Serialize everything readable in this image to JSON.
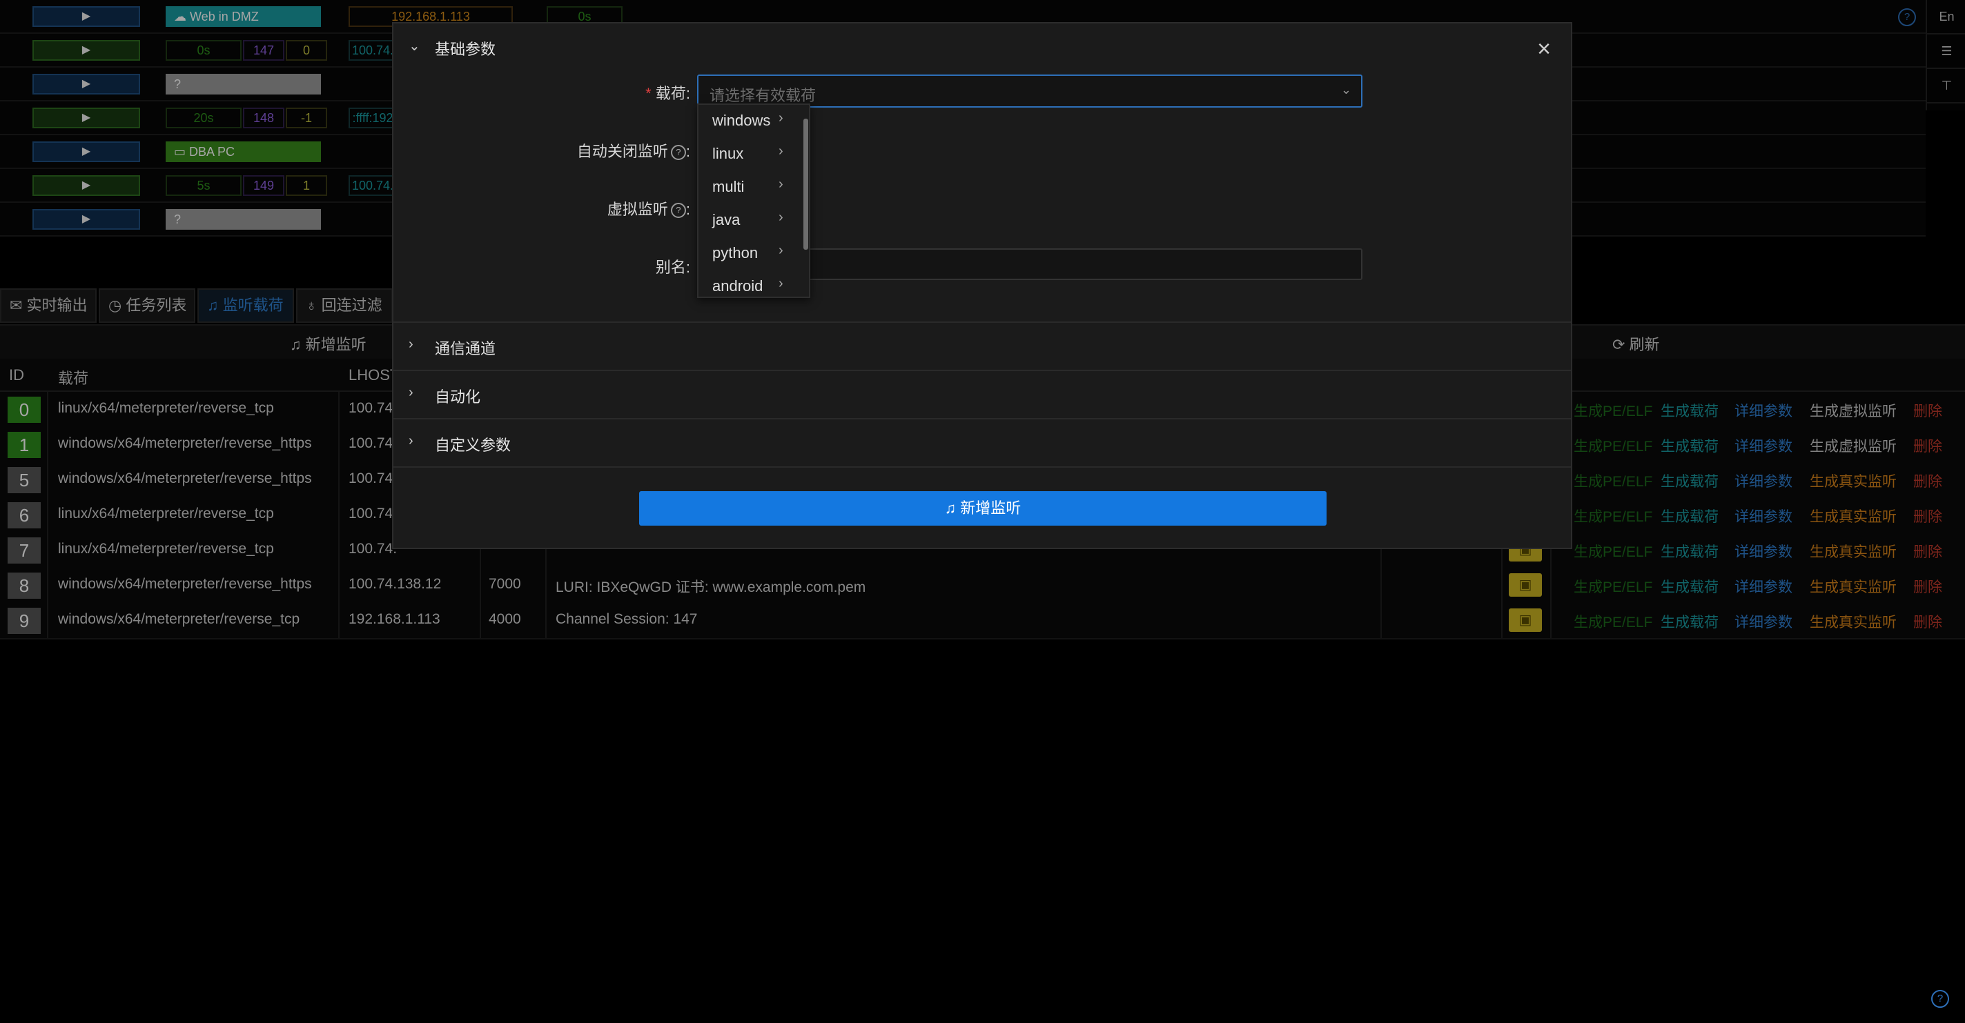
{
  "hosts": [
    {
      "tag": "Web in DMZ",
      "ip": "192.168.1.113",
      "t": "0s"
    },
    {
      "t": "0s",
      "sid": "147",
      "n": "0",
      "ip": "100.74."
    },
    {
      "tag": "?"
    },
    {
      "t": "20s",
      "sid": "148",
      "n": "-1",
      "ip": ":ffff:192"
    },
    {
      "tag": "DBA PC"
    },
    {
      "t": "5s",
      "sid": "149",
      "n": "1",
      "ip": "100.74."
    },
    {
      "tag": "?"
    }
  ],
  "right_strip": {
    "lang": "En"
  },
  "tabs": [
    "实时输出",
    "任务列表",
    "监听载荷",
    "回连过滤"
  ],
  "listener_bar": {
    "add": "新增监听",
    "refresh": "刷新"
  },
  "listener_table": {
    "headers": {
      "id": "ID",
      "payload": "载荷",
      "lhost": "LHOST"
    },
    "rows": [
      {
        "id": "0",
        "payload": "linux/x64/meterpreter/reverse_tcp",
        "lhost": "100.74.",
        "port": "",
        "info": "",
        "action4": "生成虚拟监听"
      },
      {
        "id": "1",
        "payload": "windows/x64/meterpreter/reverse_https",
        "lhost": "100.74.",
        "port": "",
        "info": "",
        "action4": "生成虚拟监听"
      },
      {
        "id": "5",
        "payload": "windows/x64/meterpreter/reverse_https",
        "lhost": "100.74.",
        "port": "",
        "info": "",
        "action4": "生成真实监听"
      },
      {
        "id": "6",
        "payload": "linux/x64/meterpreter/reverse_tcp",
        "lhost": "100.74.",
        "port": "",
        "info": "",
        "action4": "生成真实监听"
      },
      {
        "id": "7",
        "payload": "linux/x64/meterpreter/reverse_tcp",
        "lhost": "100.74.",
        "port": "",
        "info": "",
        "action4": "生成真实监听"
      },
      {
        "id": "8",
        "payload": "windows/x64/meterpreter/reverse_https",
        "lhost": "100.74.138.12",
        "port": "7000",
        "info": "LURI: IBXeQwGD  证书: www.example.com.pem",
        "action4": "生成真实监听"
      },
      {
        "id": "9",
        "payload": "windows/x64/meterpreter/reverse_tcp",
        "lhost": "192.168.1.113",
        "port": "4000",
        "info": "Channel Session: 147",
        "action4": "生成真实监听"
      }
    ],
    "actions": {
      "pe": "生成PE/ELF",
      "gen": "生成载荷",
      "detail": "详细参数",
      "delete": "删除"
    }
  },
  "modal": {
    "sections": [
      "基础参数",
      "通信通道",
      "自动化",
      "自定义参数"
    ],
    "fields": {
      "payload_label": "载荷",
      "payload_placeholder": "请选择有效载荷",
      "auto_close_label": "自动关闭监听",
      "virtual_label": "虚拟监听",
      "alias_label": "别名"
    },
    "submit": "新增监听",
    "dropdown": [
      "windows",
      "linux",
      "multi",
      "java",
      "python",
      "android"
    ]
  },
  "colors": {
    "accent": "#1478e0",
    "green": "#2d8a1c",
    "delete": "#c0392b",
    "orange": "#d4821a",
    "blue_link": "#2f7fd0"
  }
}
